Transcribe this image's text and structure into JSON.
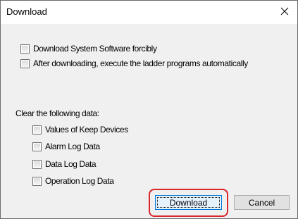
{
  "window": {
    "title": "Download",
    "close_glyph": "✕"
  },
  "options": {
    "force_download": {
      "label": "Download System Software forcibly",
      "checked": false
    },
    "execute_after": {
      "label": "After downloading, execute the ladder programs automatically",
      "checked": false
    }
  },
  "clear_section": {
    "label": "Clear the following data:",
    "items": [
      {
        "label": "Values of Keep Devices",
        "checked": false
      },
      {
        "label": "Alarm Log Data",
        "checked": false
      },
      {
        "label": "Data Log Data",
        "checked": false
      },
      {
        "label": "Operation Log Data",
        "checked": false
      }
    ]
  },
  "buttons": {
    "download_label": "Download",
    "cancel_label": "Cancel"
  },
  "colors": {
    "highlight": "#d9262b",
    "default_button_border": "#0078d7"
  },
  "icons": {
    "close": "close-icon"
  }
}
